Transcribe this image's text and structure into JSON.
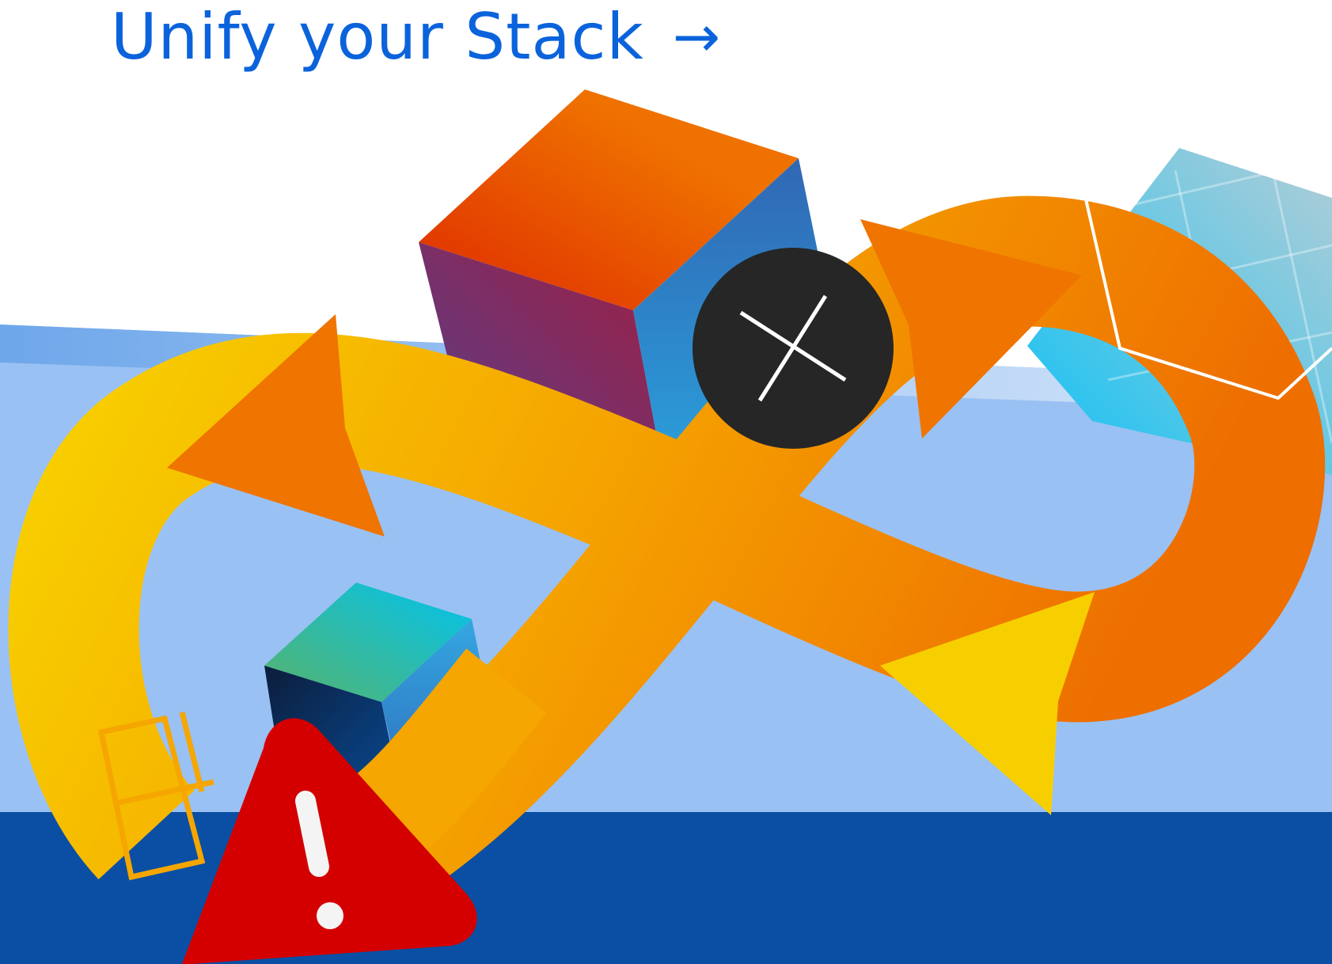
{
  "cta": {
    "label": "Unify your Stack",
    "arrow_icon": "→",
    "color": "#0b63dc"
  },
  "illustration": {
    "icons": [
      "infinity-loop-icon",
      "cube-icon",
      "close-icon",
      "warning-icon",
      "grid-panel-icon"
    ],
    "colors": {
      "sky": "#9ac1f3",
      "floor": "#0a4fa3",
      "loop_start": "#f7d000",
      "loop_end": "#ee6e00",
      "warning": "#d40000",
      "close_badge": "#262626"
    }
  }
}
